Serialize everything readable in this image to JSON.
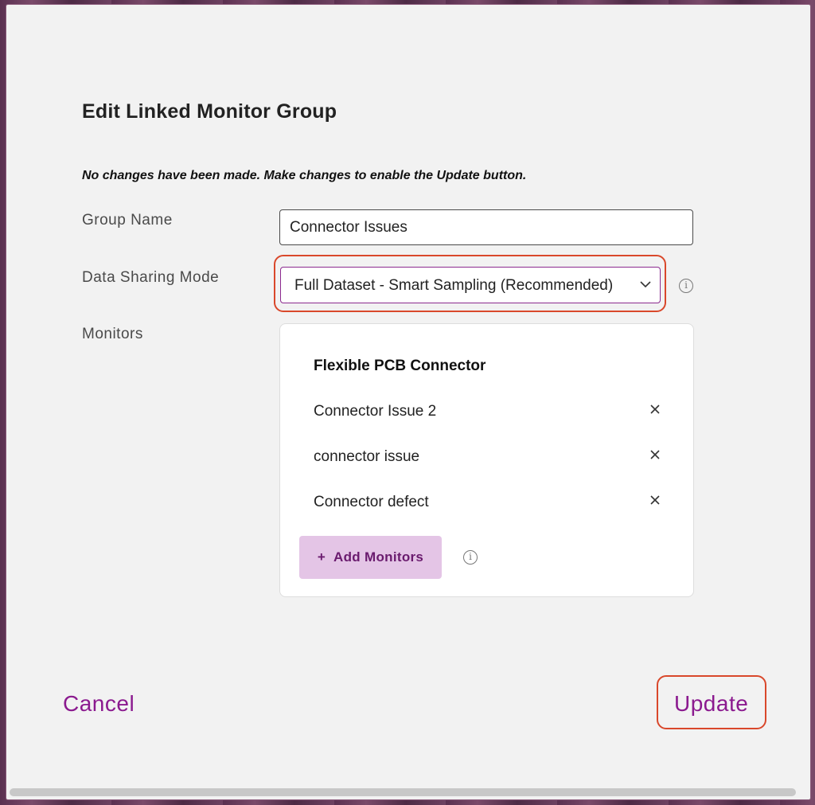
{
  "dialog": {
    "title": "Edit Linked Monitor Group",
    "notice": "No changes have been made. Make changes to enable the Update button."
  },
  "form": {
    "group_name_label": "Group Name",
    "group_name_value": "Connector Issues",
    "data_sharing_label": "Data Sharing Mode",
    "data_sharing_value": "Full Dataset - Smart Sampling (Recommended)",
    "monitors_label": "Monitors"
  },
  "monitors": {
    "group_heading": "Flexible PCB Connector",
    "items": [
      {
        "label": "Connector Issue 2"
      },
      {
        "label": "connector issue"
      },
      {
        "label": "Connector defect"
      }
    ],
    "add_plus": "+",
    "add_label": "Add Monitors"
  },
  "actions": {
    "cancel_label": "Cancel",
    "update_label": "Update"
  },
  "icons": {
    "remove": "close-icon",
    "info": "info-icon",
    "dropdown": "chevron-down-icon"
  },
  "colors": {
    "accent": "#8b1a8f",
    "highlight": "#d9482b",
    "add_button_bg": "#e4c5e6"
  }
}
